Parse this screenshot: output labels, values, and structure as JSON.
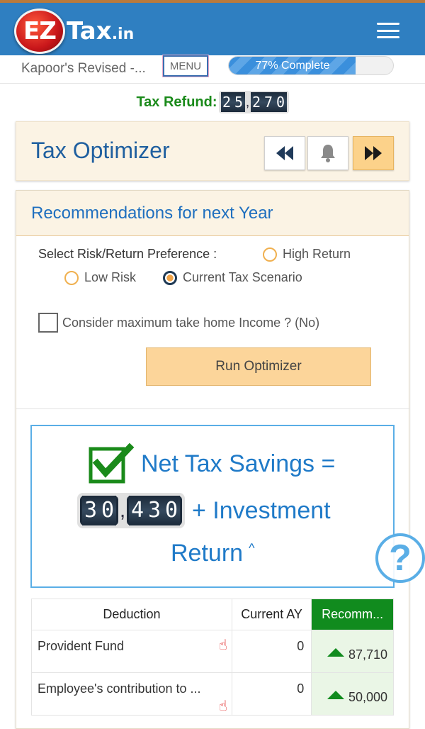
{
  "brand": {
    "logo_mark": "EZ",
    "logo_text": "Tax",
    "logo_suffix": ".in"
  },
  "header": {
    "menu_icon": "hamburger-icon"
  },
  "subbar": {
    "return_name": "Kapoor's Revised -...",
    "menu_label": "MENU",
    "progress_label": "77% Complete",
    "progress_value": 77
  },
  "refund": {
    "label": "Tax Refund:",
    "digits_group1": [
      "2",
      "5"
    ],
    "digits_group2": [
      "2",
      "7",
      "0"
    ]
  },
  "optimizer": {
    "title": "Tax Optimizer",
    "prev_icon": "fast-backward-icon",
    "bell_icon": "bell-icon",
    "next_icon": "fast-forward-icon"
  },
  "recommendations": {
    "title": "Recommendations for next Year",
    "preference_label": "Select Risk/Return Preference :",
    "options": {
      "high_return": "High Return",
      "low_risk": "Low Risk",
      "current": "Current Tax Scenario"
    },
    "selected_option": "Current Tax Scenario",
    "consider_label": "Consider maximum take home Income ? (No)",
    "run_button": "Run Optimizer"
  },
  "savings": {
    "prefix": "Net Tax Savings =",
    "digits_group1": [
      "3",
      "0"
    ],
    "digits_group2": [
      "4",
      "3",
      "0"
    ],
    "suffix": "+ Investment",
    "line3": "Return",
    "caret": "^"
  },
  "help_label": "?",
  "table": {
    "headers": [
      "Deduction",
      "Current AY",
      "Recomm..."
    ],
    "rows": [
      {
        "name": "Provident Fund",
        "current": "0",
        "recommended": "87,710"
      },
      {
        "name": "Employee's contribution to ...",
        "current": "0",
        "recommended": "50,000"
      }
    ]
  },
  "colors": {
    "header_blue": "#2f7fc1",
    "refund_green": "#1a8a1a",
    "title_blue": "#1f5f9f",
    "accent_orange": "#fcd28a",
    "rec_green": "#118b1e"
  }
}
